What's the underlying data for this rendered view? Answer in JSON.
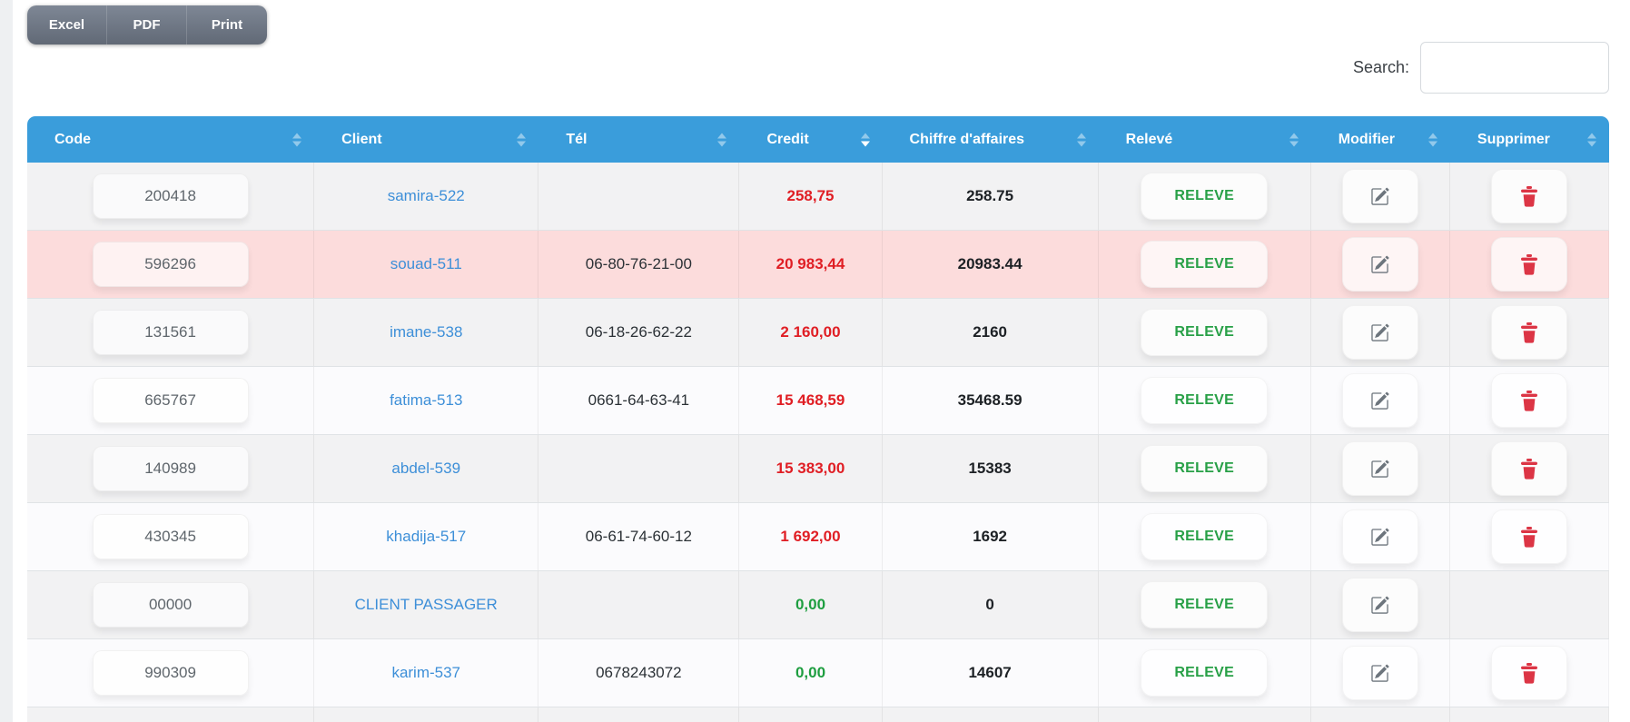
{
  "toolbar": {
    "buttons": [
      {
        "label": "Excel"
      },
      {
        "label": "PDF"
      },
      {
        "label": "Print"
      }
    ]
  },
  "search": {
    "label": "Search:",
    "value": ""
  },
  "table": {
    "columns": [
      {
        "label": "Code",
        "sort": "none"
      },
      {
        "label": "Client",
        "sort": "none"
      },
      {
        "label": "Tél",
        "sort": "none"
      },
      {
        "label": "Credit",
        "sort": "desc"
      },
      {
        "label": "Chiffre d'affaires",
        "sort": "none"
      },
      {
        "label": "Relevé",
        "sort": "none"
      },
      {
        "label": "Modifier",
        "sort": "none"
      },
      {
        "label": "Supprimer",
        "sort": "none"
      }
    ],
    "releve_button_label": "RELEVE",
    "rows": [
      {
        "code": "200418",
        "client": "samira-522",
        "tel": "",
        "credit": "258,75",
        "credit_color": "red",
        "chiffre_affaires": "258.75",
        "highlight": false,
        "has_delete": true
      },
      {
        "code": "596296",
        "client": "souad-511",
        "tel": "06-80-76-21-00",
        "credit": "20 983,44",
        "credit_color": "red",
        "chiffre_affaires": "20983.44",
        "highlight": true,
        "has_delete": true
      },
      {
        "code": "131561",
        "client": "imane-538",
        "tel": "06-18-26-62-22",
        "credit": "2 160,00",
        "credit_color": "red",
        "chiffre_affaires": "2160",
        "highlight": false,
        "has_delete": true
      },
      {
        "code": "665767",
        "client": "fatima-513",
        "tel": "0661-64-63-41",
        "credit": "15 468,59",
        "credit_color": "red",
        "chiffre_affaires": "35468.59",
        "highlight": false,
        "has_delete": true
      },
      {
        "code": "140989",
        "client": "abdel-539",
        "tel": "",
        "credit": "15 383,00",
        "credit_color": "red",
        "chiffre_affaires": "15383",
        "highlight": false,
        "has_delete": true
      },
      {
        "code": "430345",
        "client": "khadija-517",
        "tel": "06-61-74-60-12",
        "credit": "1 692,00",
        "credit_color": "red",
        "chiffre_affaires": "1692",
        "highlight": false,
        "has_delete": true
      },
      {
        "code": "00000",
        "client": "CLIENT PASSAGER",
        "tel": "",
        "credit": "0,00",
        "credit_color": "green",
        "chiffre_affaires": "0",
        "highlight": false,
        "has_delete": false
      },
      {
        "code": "990309",
        "client": "karim-537",
        "tel": "0678243072",
        "credit": "0,00",
        "credit_color": "green",
        "chiffre_affaires": "14607",
        "highlight": false,
        "has_delete": true
      }
    ]
  },
  "icons": {
    "edit": "pencil-square-icon",
    "delete": "trash-icon",
    "sort": "sort-arrows-icon"
  },
  "colors": {
    "header_bg": "#3a9ddb",
    "row_highlight_bg": "#fcdcdc",
    "credit_negative": "#e01e24",
    "credit_zero": "#1e9e40",
    "link": "#3d8fd8",
    "releve_text": "#28a047",
    "delete_icon": "#dc3545",
    "edit_icon": "#6d757d",
    "button_gray_top": "#7e8795",
    "button_gray_bottom": "#616976"
  }
}
